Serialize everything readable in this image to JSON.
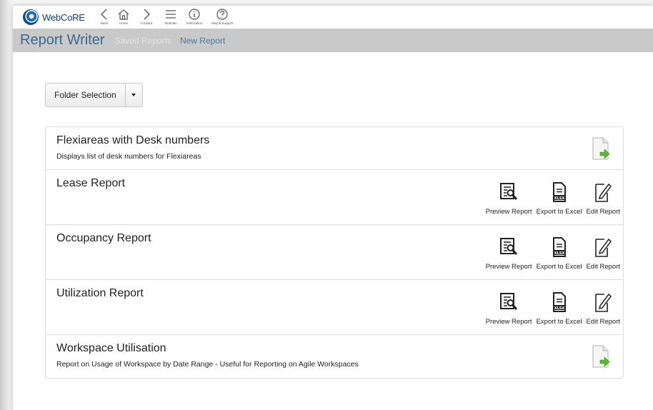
{
  "app": {
    "name": "WebCoRE"
  },
  "nav": [
    {
      "label": "Back",
      "icon": "chevron-left-icon"
    },
    {
      "label": "Home",
      "icon": "home-icon"
    },
    {
      "label": "Forward",
      "icon": "chevron-right-icon"
    },
    {
      "label": "Modules",
      "icon": "menu-icon"
    },
    {
      "label": "Information",
      "icon": "info-icon"
    },
    {
      "label": "Help & Support",
      "icon": "help-icon"
    }
  ],
  "header": {
    "title": "Report Writer",
    "links": [
      "Saved Reports",
      "New Report"
    ]
  },
  "folder_selection": {
    "label": "Folder Selection"
  },
  "actions": {
    "preview": "Preview Report",
    "export": "Export to Excel",
    "edit": "Edit Report",
    "xlsx": "XLSX"
  },
  "reports": [
    {
      "title": "Flexiareas with Desk numbers",
      "description": "Displays list of desk numbers for Flexiareas"
    },
    {
      "title": "Lease Report"
    },
    {
      "title": "Occupancy Report"
    },
    {
      "title": "Utilization Report"
    },
    {
      "title": "Workspace Utilisation",
      "description": "Report on Usage of Workspace by Date Range - Useful for Reporting on Agile Workspaces"
    }
  ],
  "colors": {
    "header_bar": "#c9c9c9",
    "title_blue": "#3b6a92",
    "run_arrow": "#5cb830"
  }
}
